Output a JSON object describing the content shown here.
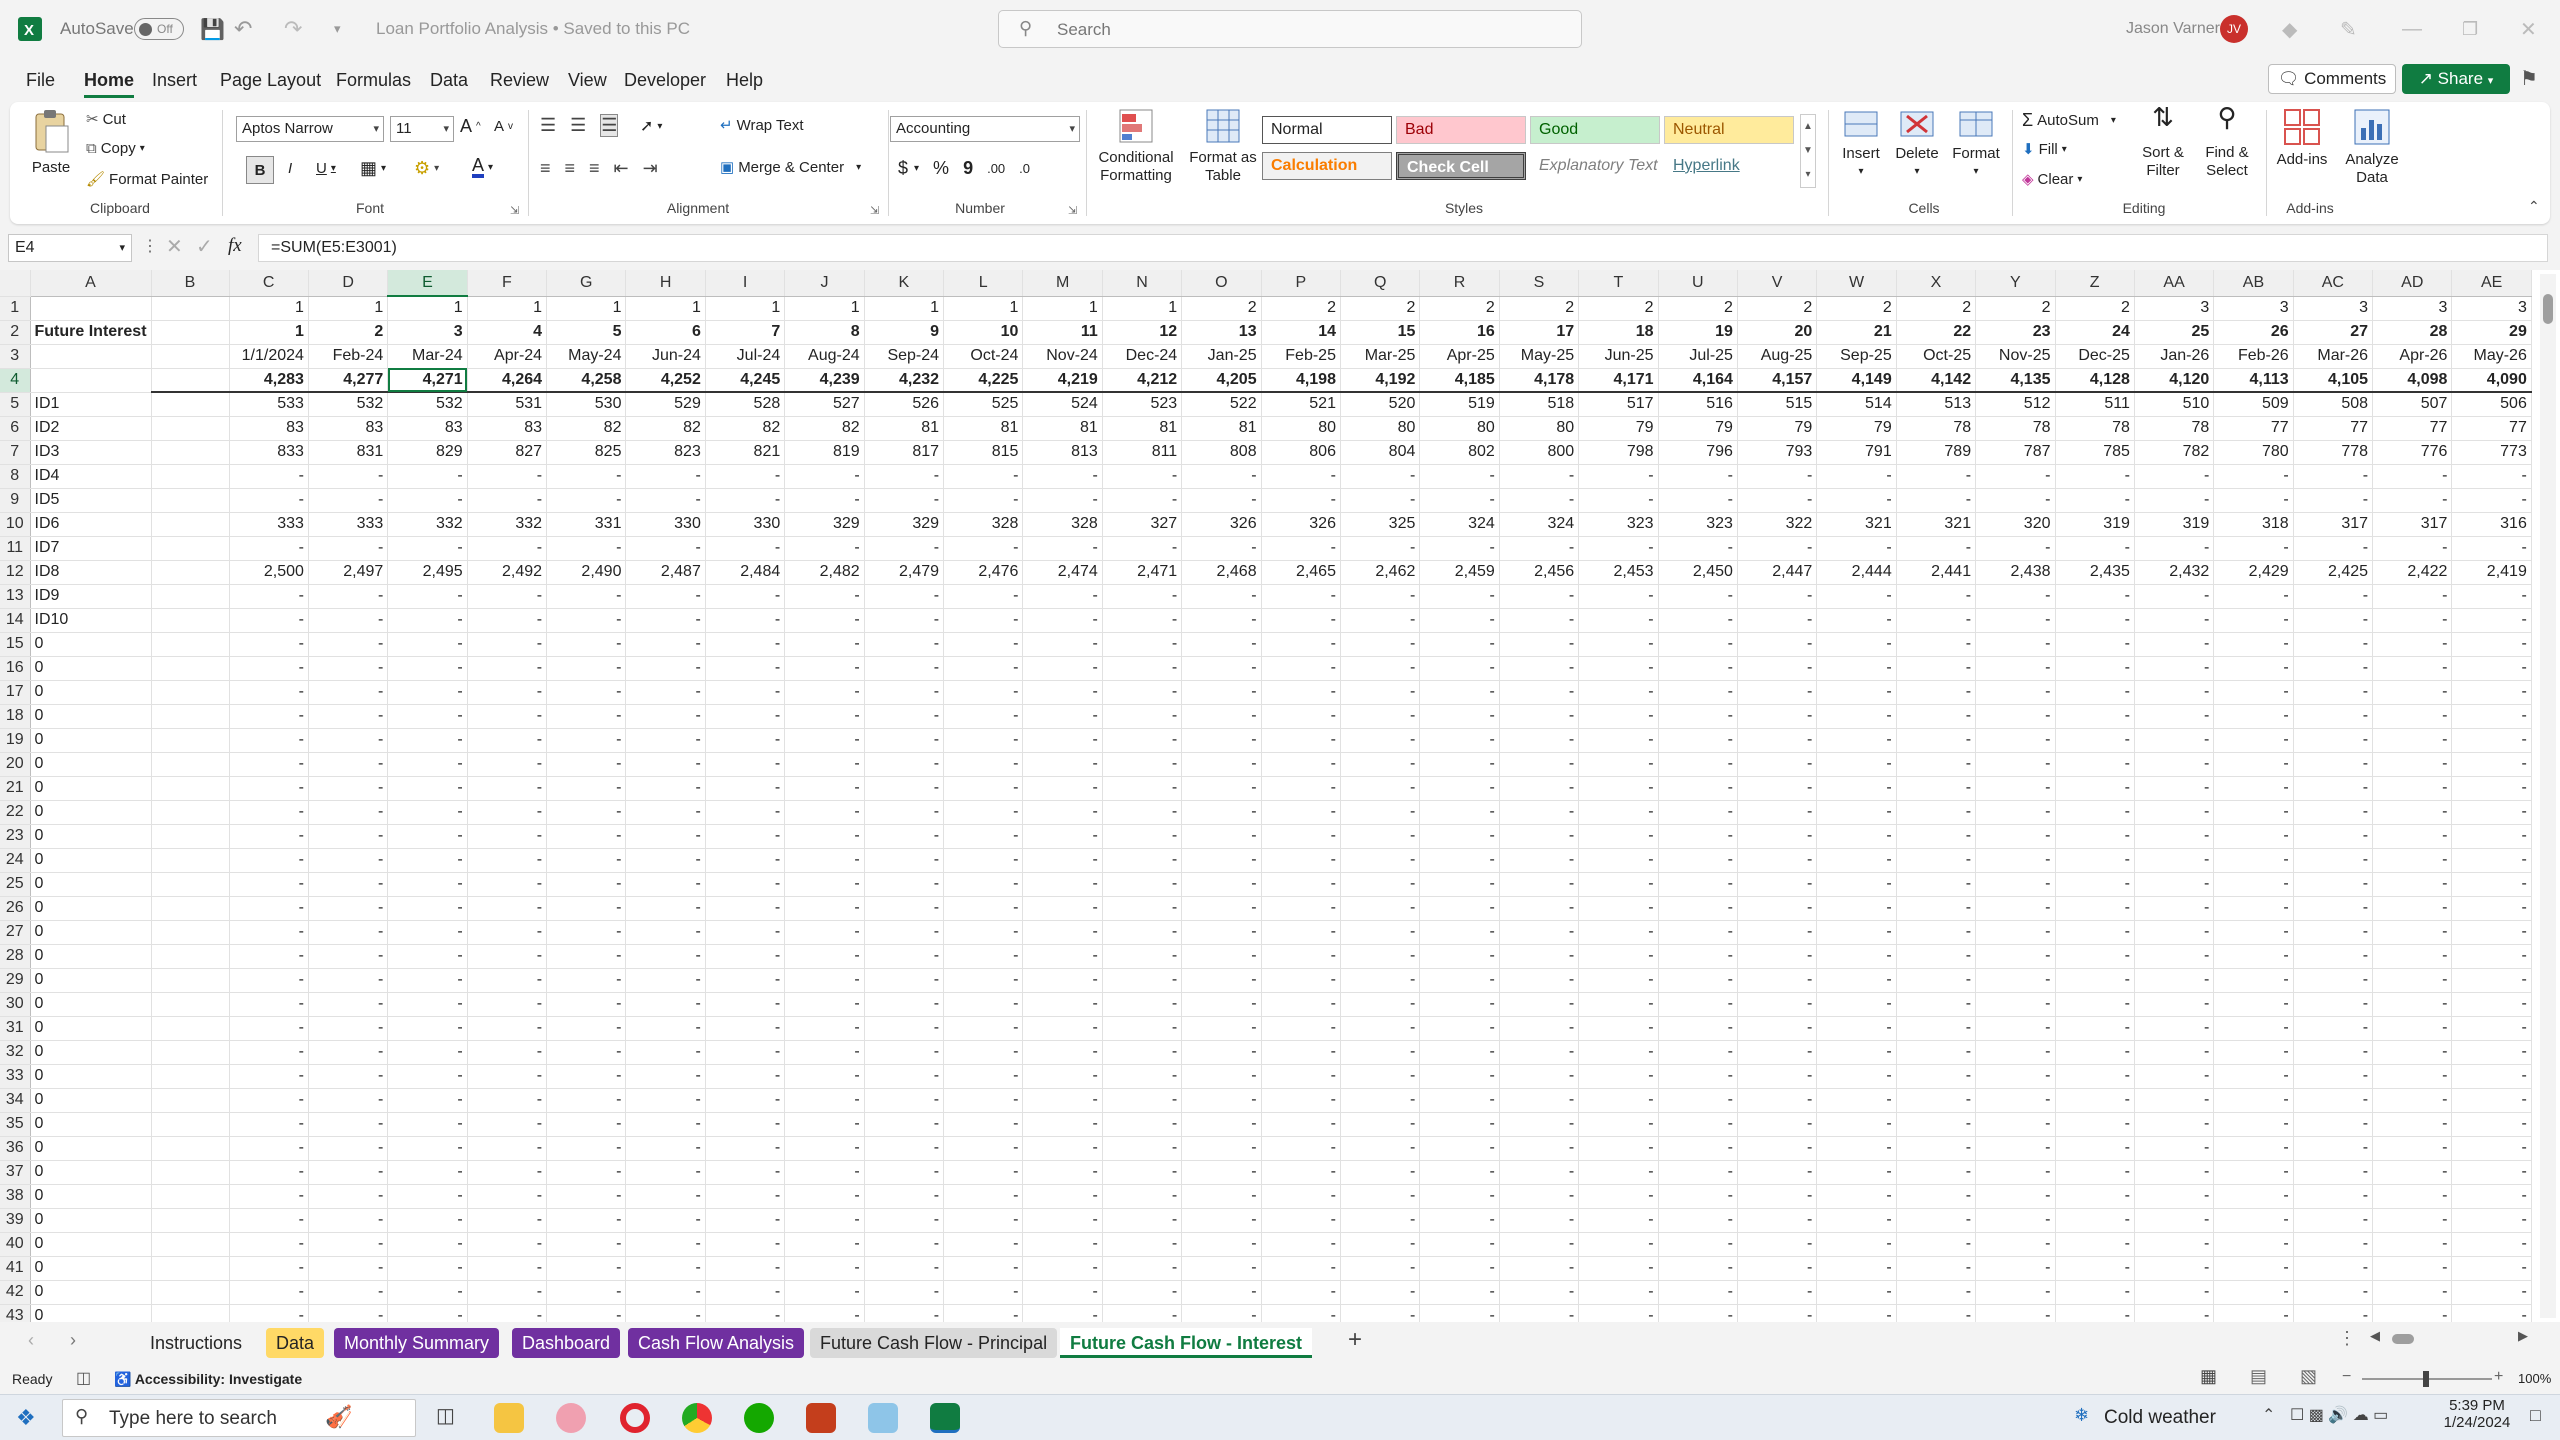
{
  "titlebar": {
    "autosave_label": "AutoSave",
    "autosave_state": "Off",
    "doc_title": "Loan Portfolio Analysis  •  Saved to this PC",
    "search_placeholder": "Search",
    "user_name": "Jason Varner",
    "user_initials": "JV"
  },
  "menu": [
    "File",
    "Home",
    "Insert",
    "Page Layout",
    "Formulas",
    "Data",
    "Review",
    "View",
    "Developer",
    "Help"
  ],
  "menu_active": "Home",
  "header_buttons": {
    "comments": "Comments",
    "share": "Share"
  },
  "ribbon": {
    "clipboard": {
      "paste": "Paste",
      "cut": "Cut",
      "copy": "Copy",
      "format_painter": "Format Painter",
      "label": "Clipboard"
    },
    "font": {
      "family": "Aptos Narrow",
      "size": "11",
      "bold": "B",
      "italic": "I",
      "underline": "U",
      "label": "Font"
    },
    "alignment": {
      "wrap": "Wrap Text",
      "merge": "Merge & Center",
      "label": "Alignment"
    },
    "number": {
      "format": "Accounting",
      "currency": "$",
      "percent": "%",
      "comma": "9",
      "label": "Number"
    },
    "styles": {
      "conditional": "Conditional Formatting",
      "format_table": "Format as Table",
      "normal": "Normal",
      "bad": "Bad",
      "good": "Good",
      "neutral": "Neutral",
      "calculation": "Calculation",
      "check_cell": "Check Cell",
      "explanatory": "Explanatory Text",
      "hyperlink": "Hyperlink",
      "label": "Styles"
    },
    "cells": {
      "insert": "Insert",
      "delete": "Delete",
      "format": "Format",
      "label": "Cells"
    },
    "editing": {
      "autosum": "AutoSum",
      "fill": "Fill",
      "clear": "Clear",
      "sort": "Sort & Filter",
      "find": "Find & Select",
      "label": "Editing"
    },
    "addins": {
      "addins": "Add-ins",
      "analyze": "Analyze Data",
      "label": "Add-ins"
    }
  },
  "formula_bar": {
    "name_box": "E4",
    "fx": "fx",
    "formula": "=SUM(E5:E3001)"
  },
  "columns": [
    "A",
    "B",
    "C",
    "D",
    "E",
    "F",
    "G",
    "H",
    "I",
    "J",
    "K",
    "L",
    "M",
    "N",
    "O",
    "P",
    "Q",
    "R",
    "S",
    "T",
    "U",
    "V",
    "W",
    "X",
    "Y",
    "Z",
    "AA",
    "AB",
    "AC",
    "AD",
    "AE"
  ],
  "rows": [
    {
      "n": "1",
      "a": "",
      "v": [
        "1",
        "1",
        "1",
        "1",
        "1",
        "1",
        "1",
        "1",
        "1",
        "1",
        "1",
        "1",
        "2",
        "2",
        "2",
        "2",
        "2",
        "2",
        "2",
        "2",
        "2",
        "2",
        "2",
        "2",
        "3",
        "3",
        "3",
        "3",
        "3"
      ]
    },
    {
      "n": "2",
      "a": "Future Interest",
      "v": [
        "1",
        "2",
        "3",
        "4",
        "5",
        "6",
        "7",
        "8",
        "9",
        "10",
        "11",
        "12",
        "13",
        "14",
        "15",
        "16",
        "17",
        "18",
        "19",
        "20",
        "21",
        "22",
        "23",
        "24",
        "25",
        "26",
        "27",
        "28",
        "29"
      ]
    },
    {
      "n": "3",
      "a": "",
      "v": [
        "1/1/2024",
        "Feb-24",
        "Mar-24",
        "Apr-24",
        "May-24",
        "Jun-24",
        "Jul-24",
        "Aug-24",
        "Sep-24",
        "Oct-24",
        "Nov-24",
        "Dec-24",
        "Jan-25",
        "Feb-25",
        "Mar-25",
        "Apr-25",
        "May-25",
        "Jun-25",
        "Jul-25",
        "Aug-25",
        "Sep-25",
        "Oct-25",
        "Nov-25",
        "Dec-25",
        "Jan-26",
        "Feb-26",
        "Mar-26",
        "Apr-26",
        "May-26"
      ]
    },
    {
      "n": "4",
      "a": "",
      "v": [
        "4,283",
        "4,277",
        "4,271",
        "4,264",
        "4,258",
        "4,252",
        "4,245",
        "4,239",
        "4,232",
        "4,225",
        "4,219",
        "4,212",
        "4,205",
        "4,198",
        "4,192",
        "4,185",
        "4,178",
        "4,171",
        "4,164",
        "4,157",
        "4,149",
        "4,142",
        "4,135",
        "4,128",
        "4,120",
        "4,113",
        "4,105",
        "4,098",
        "4,090"
      ]
    },
    {
      "n": "5",
      "a": "ID1",
      "v": [
        "533",
        "532",
        "532",
        "531",
        "530",
        "529",
        "528",
        "527",
        "526",
        "525",
        "524",
        "523",
        "522",
        "521",
        "520",
        "519",
        "518",
        "517",
        "516",
        "515",
        "514",
        "513",
        "512",
        "511",
        "510",
        "509",
        "508",
        "507",
        "506"
      ]
    },
    {
      "n": "6",
      "a": "ID2",
      "v": [
        "83",
        "83",
        "83",
        "83",
        "82",
        "82",
        "82",
        "82",
        "81",
        "81",
        "81",
        "81",
        "81",
        "80",
        "80",
        "80",
        "80",
        "79",
        "79",
        "79",
        "79",
        "78",
        "78",
        "78",
        "78",
        "77",
        "77",
        "77",
        "77"
      ]
    },
    {
      "n": "7",
      "a": "ID3",
      "v": [
        "833",
        "831",
        "829",
        "827",
        "825",
        "823",
        "821",
        "819",
        "817",
        "815",
        "813",
        "811",
        "808",
        "806",
        "804",
        "802",
        "800",
        "798",
        "796",
        "793",
        "791",
        "789",
        "787",
        "785",
        "782",
        "780",
        "778",
        "776",
        "773"
      ]
    },
    {
      "n": "8",
      "a": "ID4",
      "v": "dash"
    },
    {
      "n": "9",
      "a": "ID5",
      "v": "dash"
    },
    {
      "n": "10",
      "a": "ID6",
      "v": [
        "333",
        "333",
        "332",
        "332",
        "331",
        "330",
        "330",
        "329",
        "329",
        "328",
        "328",
        "327",
        "326",
        "326",
        "325",
        "324",
        "324",
        "323",
        "323",
        "322",
        "321",
        "321",
        "320",
        "319",
        "319",
        "318",
        "317",
        "317",
        "316"
      ]
    },
    {
      "n": "11",
      "a": "ID7",
      "v": "dash"
    },
    {
      "n": "12",
      "a": "ID8",
      "v": [
        "2,500",
        "2,497",
        "2,495",
        "2,492",
        "2,490",
        "2,487",
        "2,484",
        "2,482",
        "2,479",
        "2,476",
        "2,474",
        "2,471",
        "2,468",
        "2,465",
        "2,462",
        "2,459",
        "2,456",
        "2,453",
        "2,450",
        "2,447",
        "2,444",
        "2,441",
        "2,438",
        "2,435",
        "2,432",
        "2,429",
        "2,425",
        "2,422",
        "2,419"
      ]
    },
    {
      "n": "13",
      "a": "ID9",
      "v": "dash"
    },
    {
      "n": "14",
      "a": "ID10",
      "v": "dash"
    },
    {
      "n": "15",
      "a": "0",
      "v": "dash"
    },
    {
      "n": "16",
      "a": "0",
      "v": "dash"
    },
    {
      "n": "17",
      "a": "0",
      "v": "dash"
    },
    {
      "n": "18",
      "a": "0",
      "v": "dash"
    },
    {
      "n": "19",
      "a": "0",
      "v": "dash"
    },
    {
      "n": "20",
      "a": "0",
      "v": "dash"
    },
    {
      "n": "21",
      "a": "0",
      "v": "dash"
    },
    {
      "n": "22",
      "a": "0",
      "v": "dash"
    },
    {
      "n": "23",
      "a": "0",
      "v": "dash"
    },
    {
      "n": "24",
      "a": "0",
      "v": "dash"
    },
    {
      "n": "25",
      "a": "0",
      "v": "dash"
    },
    {
      "n": "26",
      "a": "0",
      "v": "dash"
    },
    {
      "n": "27",
      "a": "0",
      "v": "dash"
    },
    {
      "n": "28",
      "a": "0",
      "v": "dash"
    },
    {
      "n": "29",
      "a": "0",
      "v": "dash"
    },
    {
      "n": "30",
      "a": "0",
      "v": "dash"
    },
    {
      "n": "31",
      "a": "0",
      "v": "dash"
    },
    {
      "n": "32",
      "a": "0",
      "v": "dash"
    },
    {
      "n": "33",
      "a": "0",
      "v": "dash"
    },
    {
      "n": "34",
      "a": "0",
      "v": "dash"
    },
    {
      "n": "35",
      "a": "0",
      "v": "dash"
    },
    {
      "n": "36",
      "a": "0",
      "v": "dash"
    },
    {
      "n": "37",
      "a": "0",
      "v": "dash"
    },
    {
      "n": "38",
      "a": "0",
      "v": "dash"
    },
    {
      "n": "39",
      "a": "0",
      "v": "dash"
    },
    {
      "n": "40",
      "a": "0",
      "v": "dash"
    },
    {
      "n": "41",
      "a": "0",
      "v": "dash"
    },
    {
      "n": "42",
      "a": "0",
      "v": "dash"
    },
    {
      "n": "43",
      "a": "0",
      "v": "dash"
    }
  ],
  "sheet_tabs": [
    {
      "label": "Instructions",
      "style": "plain"
    },
    {
      "label": "Data",
      "style": "yellow"
    },
    {
      "label": "Monthly Summary",
      "style": "purple"
    },
    {
      "label": "Dashboard",
      "style": "purple"
    },
    {
      "label": "Cash Flow Analysis",
      "style": "purple"
    },
    {
      "label": "Future Cash Flow - Principal",
      "style": "gray"
    },
    {
      "label": "Future Cash Flow - Interest",
      "style": "active"
    }
  ],
  "colors": {
    "excel_green": "#107c41",
    "tab_purple": "#7030a0",
    "tab_yellow": "#ffd966",
    "tab_gray": "#d9d9d9"
  },
  "status": {
    "ready": "Ready",
    "accessibility": "Accessibility: Investigate",
    "zoom": "100%"
  },
  "taskbar": {
    "search_placeholder": "Type here to search",
    "weather": "Cold weather",
    "time": "5:39 PM",
    "date": "1/24/2024"
  }
}
